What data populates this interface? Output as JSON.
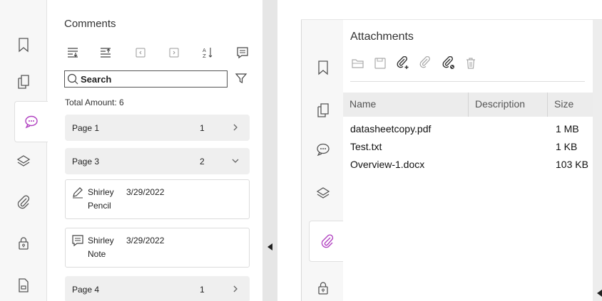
{
  "left_panel": {
    "title": "Comments",
    "search": {
      "placeholder": "Search",
      "value": ""
    },
    "total_amount": "Total Amount: 6",
    "rail_icons": [
      "bookmark-icon",
      "pages-icon",
      "comment-icon",
      "layers-icon",
      "attachment-icon",
      "lock-icon",
      "document-icon"
    ],
    "active_rail": "comment-icon",
    "toolbar_icons": [
      "expand-all-icon",
      "collapse-all-icon",
      "previous-icon",
      "next-icon",
      "sort-icon",
      "summary-icon"
    ],
    "groups": [
      {
        "label": "Page 1",
        "count": "1",
        "expanded": false
      },
      {
        "label": "Page 3",
        "count": "2",
        "expanded": true
      },
      {
        "label": "Page 4",
        "count": "1",
        "expanded": false
      }
    ],
    "comments": [
      {
        "icon": "pencil-icon",
        "author": "Shirley",
        "date": "3/29/2022",
        "type": "Pencil"
      },
      {
        "icon": "note-icon",
        "author": "Shirley",
        "date": "3/29/2022",
        "type": "Note"
      }
    ]
  },
  "right_panel": {
    "title": "Attachments",
    "rail_icons": [
      "bookmark-icon",
      "pages-icon",
      "comment-icon",
      "layers-icon",
      "attachment-icon",
      "lock-icon"
    ],
    "active_rail": "attachment-icon",
    "toolbar_icons": [
      "open-icon",
      "save-icon",
      "add-attachment-icon",
      "edit-attachment-icon",
      "remove-attachment-icon",
      "delete-icon"
    ],
    "columns": [
      "Name",
      "Description",
      "Size"
    ],
    "files": [
      {
        "name": "datasheetcopy.pdf",
        "description": "",
        "size": "1 MB"
      },
      {
        "name": "Test.txt",
        "description": "",
        "size": "1 KB"
      },
      {
        "name": "Overview-1.docx",
        "description": "",
        "size": "103 KB"
      }
    ]
  },
  "colors": {
    "accent_comment": "#b040c0",
    "accent_attachment": "#b040c0",
    "icon_gray": "#555555",
    "row_bg": "#efefef"
  }
}
